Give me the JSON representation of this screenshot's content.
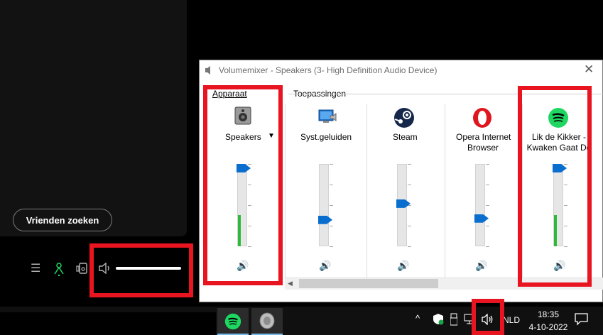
{
  "spotify": {
    "friends_button": "Vrienden zoeken",
    "volume_level": 1.0
  },
  "mixer": {
    "title": "Volumemixer - Speakers (3- High Definition Audio Device)",
    "close": "✕",
    "group_device": "Apparaat",
    "group_apps": "Toepassingen",
    "channels": [
      {
        "name_line1": "Speakers",
        "name_line2": "",
        "icon": "speaker-device-icon",
        "level": 1.0,
        "peak": 0.38
      },
      {
        "name_line1": "Syst.geluiden",
        "name_line2": "",
        "icon": "system-sounds-icon",
        "level": 0.3,
        "peak": 0
      },
      {
        "name_line1": "Steam",
        "name_line2": "",
        "icon": "steam-icon",
        "level": 0.52,
        "peak": 0
      },
      {
        "name_line1": "Opera Internet",
        "name_line2": "Browser",
        "icon": "opera-icon",
        "level": 0.32,
        "peak": 0
      },
      {
        "name_line1": "Lik de Kikker -",
        "name_line2": "Kwaken Gaat Do",
        "icon": "spotify-icon",
        "level": 1.0,
        "peak": 0.38
      }
    ]
  },
  "taskbar": {
    "language": "NLD",
    "time": "18:35",
    "date": "4-10-2022"
  },
  "colors": {
    "highlight": "#e8141f",
    "slider_thumb": "#0a6ecf",
    "peak_meter": "#2fb93a",
    "spotify_green": "#1ed760"
  }
}
